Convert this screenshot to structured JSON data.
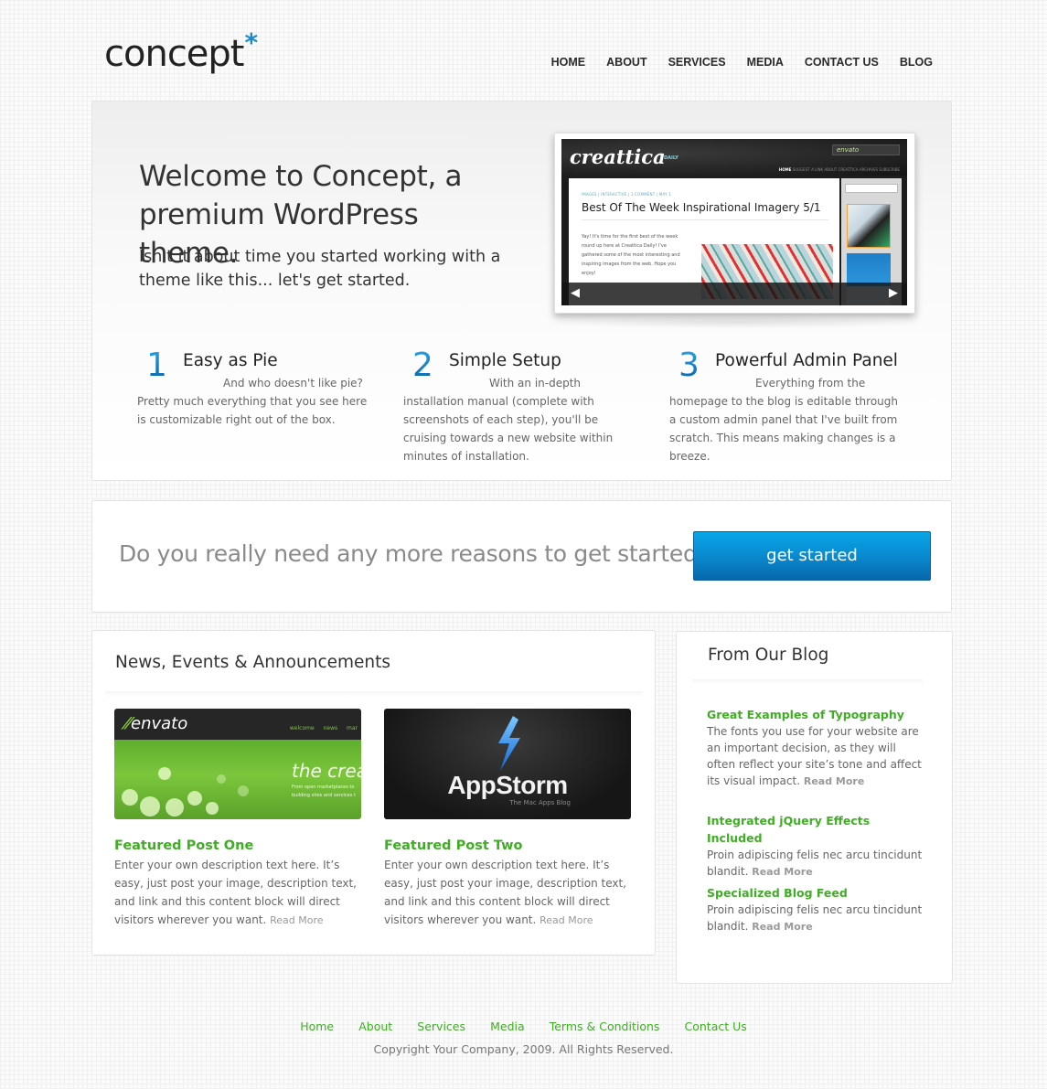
{
  "header": {
    "logo_text": "concept",
    "logo_mark": "*",
    "nav": [
      "HOME",
      "ABOUT",
      "SERVICES",
      "MEDIA",
      "CONTACT US",
      "BLOG"
    ]
  },
  "hero": {
    "title": "Welcome to Concept, a premium WordPress theme.",
    "subtitle": "Isn't it about time you started working with a theme like this... let's get started.",
    "screenshot": {
      "brand": "creattica",
      "brand_suffix": "DAILY",
      "partner_badge": "envato",
      "nav_active": "HOME",
      "nav_rest": "SUGGEST A LINK   ABOUT CREATTICA   ARCHIVES   SUBSCRIBE",
      "breadcrumbs": "IMAGES | INTERACTIVE | 1 COMMENT | MAY 1",
      "headline": "Best Of The Week Inspirational Imagery 5/1",
      "excerpt": "Yay! It's time for the first best of the week round up here at Creattica Daily! I've gathered some of the most interesting and inspiring images from the web. Hope you enjoy!",
      "prev_icon": "◀",
      "next_icon": "▶"
    }
  },
  "features": [
    {
      "number": "1",
      "title": "Easy as Pie",
      "body": "And who doesn't like pie? Pretty much everything that you see here is customizable right out of the box."
    },
    {
      "number": "2",
      "title": "Simple Setup",
      "body": "With an in-depth installation manual (complete with screenshots of each step), you'll be cruising towards a new website within minutes of installation."
    },
    {
      "number": "3",
      "title": "Powerful Admin Panel",
      "body": "Everything from the homepage to the blog is editable through a custom admin panel that I've built from scratch. This means making changes is a breeze."
    }
  ],
  "cta": {
    "text": "Do you really need any more reasons to get started?",
    "button_label": "get started"
  },
  "news": {
    "title": "News, Events & Announcements",
    "thumb1": {
      "logo": "envato",
      "nav": "welcome news mar",
      "tagline": "the creat",
      "sub1": "From open marketplaces to",
      "sub2": "building sites and services t"
    },
    "thumb2": {
      "name": "AppStorm",
      "sub": "The Mac Apps Blog"
    },
    "posts": [
      {
        "title": "Featured Post One",
        "body": "Enter your own description text here. It’s easy, just post your image, description text, and link and this content block will direct visitors wherever you want.",
        "read_more": "Read More"
      },
      {
        "title": "Featured Post Two",
        "body": "Enter your own description text here. It’s easy, just post your image, description text, and link and this content block will direct visitors wherever you want.",
        "read_more": "Read More"
      }
    ]
  },
  "blog": {
    "title": "From Our Blog",
    "posts": [
      {
        "title": "Great Examples of Typography",
        "body": "The fonts you use for your website are an important decision, as they will often reflect your site’s tone and affect its visual impact.",
        "read_more": "Read More"
      },
      {
        "title": "Integrated jQuery Effects Included",
        "body": "Proin adipiscing felis nec arcu tincidunt blandit.",
        "read_more": "Read More"
      },
      {
        "title": "Specialized Blog Feed",
        "body": "Proin adipiscing felis nec arcu tincidunt blandit.",
        "read_more": "Read More"
      }
    ]
  },
  "footer": {
    "links": [
      "Home",
      "About",
      "Services",
      "Media",
      "Terms & Conditions",
      "Contact Us"
    ],
    "copyright": "Copyright Your Company, 2009. All Rights Reserved."
  },
  "colors": {
    "accent_blue": "#0a8ad0",
    "link_green": "#3fae24",
    "text_dark": "#333333",
    "text_muted": "#666666"
  }
}
